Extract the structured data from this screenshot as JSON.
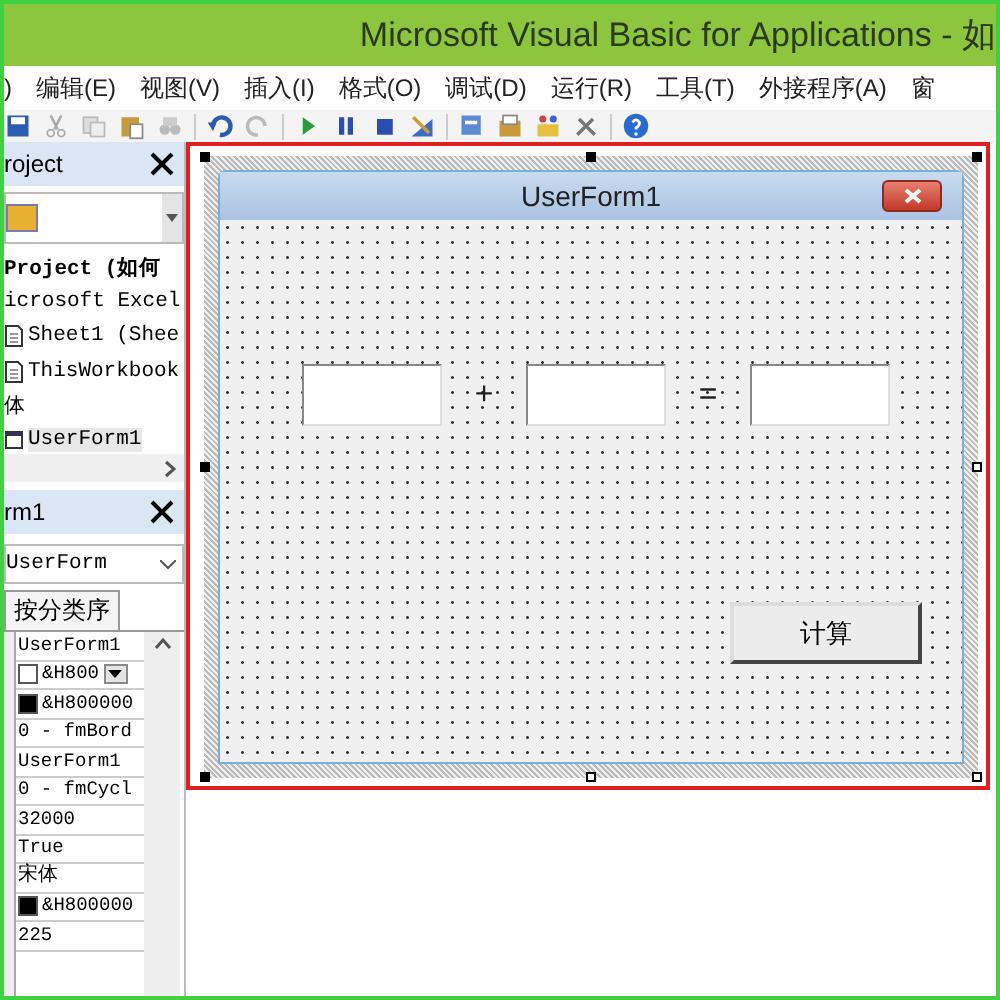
{
  "window": {
    "title": "Microsoft Visual Basic for Applications - 如"
  },
  "menu": [
    ")",
    "编辑(E)",
    "视图(V)",
    "插入(I)",
    "格式(O)",
    "调试(D)",
    "运行(R)",
    "工具(T)",
    "外接程序(A)",
    "窗"
  ],
  "project_pane": {
    "title": "roject",
    "tree": [
      {
        "label": "Project (如何",
        "kind": "root",
        "selected": false,
        "children": [
          {
            "label": "icrosoft Excel",
            "selected": false,
            "children": [
              {
                "label": "Sheet1 (Shee",
                "kind": "doc",
                "selected": false
              },
              {
                "label": "ThisWorkbook",
                "kind": "doc",
                "selected": false
              }
            ]
          },
          {
            "label": "体",
            "selected": false,
            "children": [
              {
                "label": "UserForm1",
                "kind": "form",
                "selected": true
              }
            ]
          }
        ]
      }
    ]
  },
  "properties_pane": {
    "title": "rm1",
    "object": "UserForm",
    "tab": "按分类序",
    "values": [
      {
        "text": "UserForm1",
        "kind": "text"
      },
      {
        "text": "&H800",
        "kind": "color",
        "color": "#ffffff",
        "dropdown": true
      },
      {
        "text": "&H800000",
        "kind": "color",
        "color": "#000000",
        "dropdown": false
      },
      {
        "text": "0 - fmBord",
        "kind": "text"
      },
      {
        "text": "UserForm1",
        "kind": "text"
      },
      {
        "text": "0 - fmCycl",
        "kind": "text"
      },
      {
        "text": "32000",
        "kind": "text"
      },
      {
        "text": "True",
        "kind": "text"
      },
      {
        "text": "宋体",
        "kind": "text"
      },
      {
        "text": "&H800000",
        "kind": "color",
        "color": "#000000",
        "dropdown": false
      },
      {
        "text": "225",
        "kind": "text"
      }
    ]
  },
  "userform": {
    "title": "UserForm1",
    "operators": [
      "+",
      "="
    ],
    "button": "计算"
  }
}
